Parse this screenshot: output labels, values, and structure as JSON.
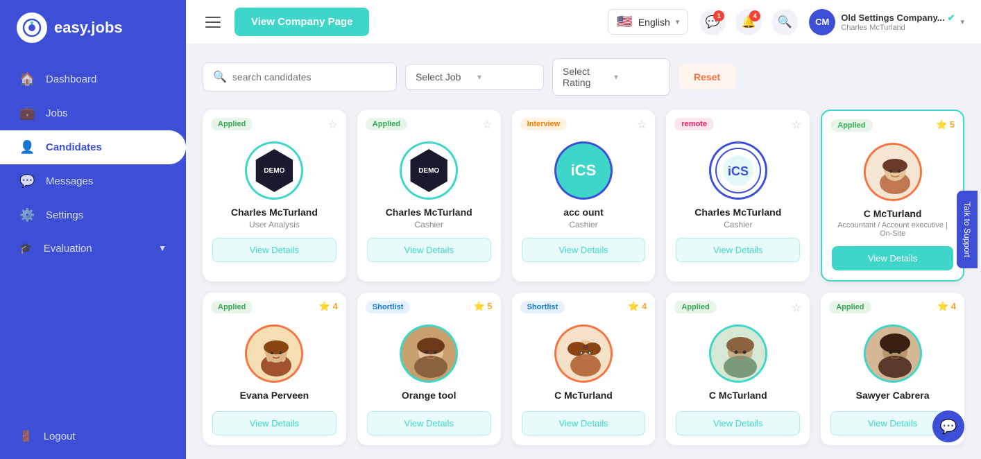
{
  "app": {
    "name": "easy.jobs"
  },
  "sidebar": {
    "items": [
      {
        "id": "dashboard",
        "label": "Dashboard",
        "icon": "🏠"
      },
      {
        "id": "jobs",
        "label": "Jobs",
        "icon": "💼"
      },
      {
        "id": "candidates",
        "label": "Candidates",
        "icon": "👤",
        "active": true
      },
      {
        "id": "messages",
        "label": "Messages",
        "icon": "💬"
      },
      {
        "id": "settings",
        "label": "Settings",
        "icon": "⚙️"
      },
      {
        "id": "evaluation",
        "label": "Evaluation",
        "icon": "🎓",
        "hasChevron": true
      }
    ],
    "logout": {
      "label": "Logout",
      "icon": "🚪"
    }
  },
  "topbar": {
    "view_company_btn": "View Company Page",
    "language": "English",
    "notifications": {
      "messages": 1,
      "alerts": 4
    },
    "company": "Old Settings Company...",
    "user": "Charles McTurland",
    "search_icon_label": "search-icon",
    "settings_icon_label": "settings-icon"
  },
  "filters": {
    "search_placeholder": "search candidates",
    "select_job_label": "Select Job",
    "select_rating_label": "Select Rating",
    "reset_btn": "Reset"
  },
  "candidates_row1": [
    {
      "id": "c1",
      "name": "Charles McTurland",
      "job": "User Analysis",
      "badge": "Applied",
      "badge_type": "applied",
      "avatar_type": "demo",
      "starred": false,
      "rating": null,
      "btn": "View Details",
      "btn_active": false
    },
    {
      "id": "c2",
      "name": "Charles McTurland",
      "job": "Cashier",
      "badge": "Applied",
      "badge_type": "applied",
      "avatar_type": "demo",
      "starred": false,
      "rating": null,
      "btn": "View Details",
      "btn_active": false
    },
    {
      "id": "c3",
      "name": "acc ount",
      "job": "Cashier",
      "badge": "Interview",
      "badge_type": "interview",
      "avatar_type": "ics",
      "starred": false,
      "rating": null,
      "btn": "View Details",
      "btn_active": false
    },
    {
      "id": "c4",
      "name": "Charles McTurland",
      "job": "Cashier",
      "badge": "remote",
      "badge_type": "remote",
      "avatar_type": "ics2",
      "starred": false,
      "rating": null,
      "btn": "View Details",
      "btn_active": false
    },
    {
      "id": "c5",
      "name": "C McTurland",
      "job": "Accountant / Account executive | On-Site",
      "badge": "Applied",
      "badge_type": "applied",
      "avatar_type": "person1",
      "starred": true,
      "rating": 5,
      "btn": "View Details",
      "btn_active": true
    }
  ],
  "candidates_row2": [
    {
      "id": "c6",
      "name": "Evana Perveen",
      "job": "",
      "badge": "Applied",
      "badge_type": "applied",
      "avatar_type": "person2",
      "starred": true,
      "rating": 4,
      "btn": "View Details",
      "btn_active": false
    },
    {
      "id": "c7",
      "name": "Orange tool",
      "job": "",
      "badge": "Shortlist",
      "badge_type": "shortlist",
      "avatar_type": "person3",
      "starred": true,
      "rating": 5,
      "btn": "View Details",
      "btn_active": false
    },
    {
      "id": "c8",
      "name": "C McTurland",
      "job": "",
      "badge": "Shortlist",
      "badge_type": "shortlist",
      "avatar_type": "person4",
      "starred": true,
      "rating": 4,
      "btn": "View Details",
      "btn_active": false
    },
    {
      "id": "c9",
      "name": "C McTurland",
      "job": "",
      "badge": "Applied",
      "badge_type": "applied",
      "avatar_type": "person5",
      "starred": false,
      "rating": null,
      "btn": "View Details",
      "btn_active": false
    },
    {
      "id": "c10",
      "name": "Sawyer Cabrera",
      "job": "",
      "badge": "Applied",
      "badge_type": "applied",
      "avatar_type": "person6",
      "starred": true,
      "rating": 4,
      "btn": "View Details",
      "btn_active": false
    }
  ],
  "support": {
    "label": "Talk to Support"
  },
  "chat_fab": {
    "icon": "💬"
  }
}
